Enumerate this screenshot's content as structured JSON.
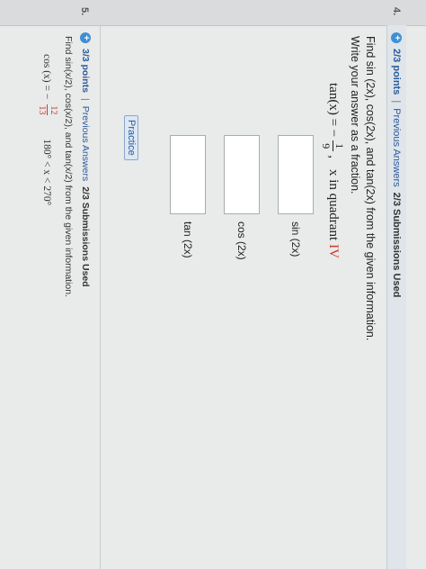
{
  "question4": {
    "number": "4.",
    "points": "2/3 points",
    "separator": "|",
    "previous_answers": "Previous Answers",
    "submissions": "2/3 Submissions Used",
    "prompt_line1": "Find sin (2x), cos(2x), and tan(2x) from the given information.",
    "prompt_line2": "Write your answer as a fraction.",
    "eq_lhs": "tan(x) = −",
    "eq_num": "1",
    "eq_den": "9",
    "eq_comma": ",",
    "eq_condition": "x in quadrant",
    "eq_quadrant": "IV",
    "answers": [
      {
        "label": "sin (2x)",
        "value": ""
      },
      {
        "label": "cos (2x)",
        "value": ""
      },
      {
        "label": "tan (2x)",
        "value": ""
      }
    ],
    "practice": "Practice"
  },
  "question5": {
    "number": "5.",
    "points": "3/3 points",
    "separator": "|",
    "previous_answers": "Previous Answers",
    "submissions": "2/3 Submissions Used",
    "prompt": "Find sin(x/2), cos(x/2), and tan(x/2) from the given information.",
    "eq_lhs": "cos (x) = −",
    "eq_num": "12",
    "eq_den": "13",
    "eq_range": "180° < x < 270°"
  },
  "colors": {
    "accent": "#3f8fd2",
    "link": "#2a5a9c",
    "highlight": "#c43c2f"
  }
}
